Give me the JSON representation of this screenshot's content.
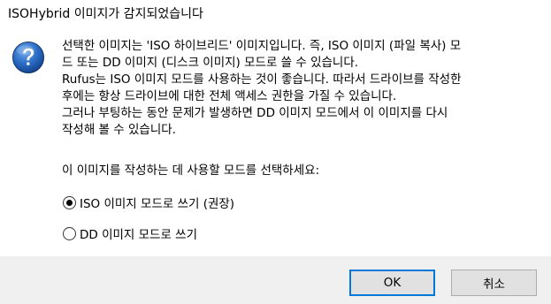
{
  "dialog": {
    "title": "ISOHybrid 이미지가 감지되었습니다",
    "icon": "question-icon",
    "message_lines": [
      "선택한 이미지는 'ISO 하이브리드' 이미지입니다. 즉, ISO 이미지 (파일 복사) 모",
      "드 또는 DD 이미지 (디스크 이미지) 모드로 쓸 수 있습니다.",
      "Rufus는 ISO 이미지 모드를 사용하는 것이 좋습니다. 따라서 드라이브를 작성한",
      "후에는 항상 드라이브에 대한 전체 액세스 권한을 가질 수 있습니다.",
      "그러나 부팅하는 동안 문제가 발생하면 DD 이미지 모드에서 이 이미지를 다시",
      "작성해 볼 수 있습니다."
    ],
    "prompt": "이 이미지를 작성하는 데 사용할 모드를 선택하세요:",
    "options": {
      "iso": {
        "label": "ISO 이미지 모드로 쓰기 (권장)",
        "selected": true
      },
      "dd": {
        "label": "DD 이미지 모드로 쓰기",
        "selected": false
      }
    },
    "buttons": {
      "ok": "OK",
      "cancel": "취소"
    },
    "colors": {
      "icon_blue": "#1f5fb0",
      "accent": "#0078d7",
      "footer_bg": "#f0f0f0",
      "button_bg": "#e1e1e1"
    }
  }
}
